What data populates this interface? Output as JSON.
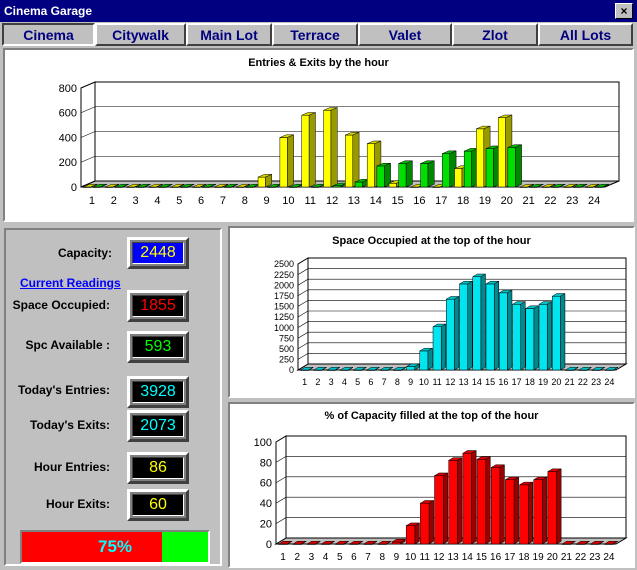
{
  "window": {
    "title": "Cinema Garage",
    "close_label": "×"
  },
  "tabs": [
    {
      "label": "Cinema",
      "active": true
    },
    {
      "label": "Citywalk",
      "active": false
    },
    {
      "label": "Main Lot",
      "active": false
    },
    {
      "label": "Terrace",
      "active": false
    },
    {
      "label": "Valet",
      "active": false
    },
    {
      "label": "Zlot",
      "active": false
    },
    {
      "label": "All Lots",
      "active": false
    }
  ],
  "readings": {
    "capacity_label": "Capacity:",
    "capacity_value": "2448",
    "current_link": "Current Readings",
    "occupied_label": "Space Occupied:",
    "occupied_value": "1855",
    "available_label": "Spc Available :",
    "available_value": "593",
    "entries_label": "Today's Entries:",
    "entries_value": "3928",
    "exits_label": "Today's Exits:",
    "exits_value": "2073",
    "hour_entries_label": "Hour Entries:",
    "hour_entries_value": "86",
    "hour_exits_label": "Hour Exits:",
    "hour_exits_value": "60"
  },
  "progress": {
    "text": "75%",
    "fraction": 0.75
  },
  "colors": {
    "capacity_bg": "#0000ff",
    "capacity_fg": "#ffff00",
    "occupied_fg": "#ff0000",
    "available_fg": "#00ff00",
    "entries_fg": "#00ffff",
    "hour_fg": "#ffff00",
    "entries_bar": "#ffff00",
    "exits_bar": "#00e000",
    "occupied_bar": "#00e5ee",
    "percent_bar": "#ff0000"
  },
  "chart_data": [
    {
      "type": "bar",
      "title": "Entries & Exits by the hour",
      "categories": [
        "1",
        "2",
        "3",
        "4",
        "5",
        "6",
        "7",
        "8",
        "9",
        "10",
        "11",
        "12",
        "13",
        "14",
        "15",
        "16",
        "17",
        "18",
        "19",
        "20",
        "21",
        "22",
        "23",
        "24"
      ],
      "yticks": [
        "0",
        "200",
        "400",
        "600",
        "800"
      ],
      "ylim": [
        0,
        800
      ],
      "series": [
        {
          "values": [
            0,
            0,
            0,
            0,
            0,
            0,
            0,
            0,
            80,
            400,
            580,
            620,
            420,
            350,
            30,
            0,
            0,
            150,
            470,
            560,
            0,
            0,
            0,
            0
          ]
        },
        {
          "values": [
            0,
            0,
            0,
            0,
            0,
            0,
            0,
            0,
            0,
            0,
            0,
            10,
            40,
            170,
            190,
            190,
            270,
            290,
            310,
            320,
            0,
            0,
            0,
            0
          ]
        }
      ],
      "grid": true
    },
    {
      "type": "bar",
      "title": "Space Occupied at the top of the hour",
      "categories": [
        "1",
        "2",
        "3",
        "4",
        "5",
        "6",
        "7",
        "8",
        "9",
        "10",
        "11",
        "12",
        "13",
        "14",
        "15",
        "16",
        "17",
        "18",
        "19",
        "20",
        "21",
        "22",
        "23",
        "24"
      ],
      "yticks": [
        "0",
        "250",
        "500",
        "750",
        "1000",
        "1250",
        "1500",
        "1750",
        "2000",
        "2250",
        "2500"
      ],
      "ylim": [
        0,
        2500
      ],
      "values": [
        0,
        0,
        0,
        0,
        0,
        0,
        0,
        0,
        80,
        450,
        1020,
        1670,
        2030,
        2200,
        2030,
        1820,
        1550,
        1450,
        1550,
        1740,
        0,
        0,
        0,
        0
      ],
      "grid": true
    },
    {
      "type": "bar",
      "title": "% of Capacity filled at the top of the hour",
      "categories": [
        "1",
        "2",
        "3",
        "4",
        "5",
        "6",
        "7",
        "8",
        "9",
        "10",
        "11",
        "12",
        "13",
        "14",
        "15",
        "16",
        "17",
        "18",
        "19",
        "20",
        "21",
        "22",
        "23",
        "24"
      ],
      "yticks": [
        "0",
        "20",
        "40",
        "60",
        "80",
        "100"
      ],
      "ylim": [
        0,
        100
      ],
      "values": [
        0,
        0,
        0,
        0,
        0,
        0,
        0,
        0,
        2,
        18,
        40,
        67,
        82,
        89,
        83,
        75,
        63,
        58,
        63,
        71,
        0,
        0,
        0,
        0
      ],
      "grid": true
    }
  ]
}
